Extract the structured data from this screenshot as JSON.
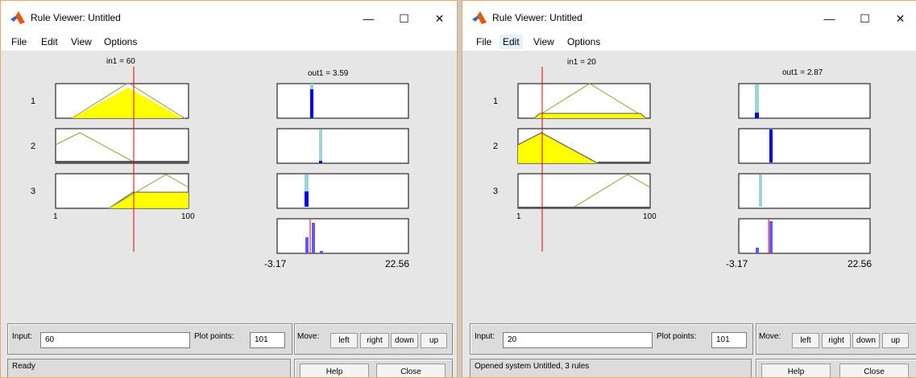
{
  "colors": {
    "membership_fill": "#ffff00",
    "membership_line": "#9a9a4a",
    "input_line": "#e00000",
    "output_bar": "#0000d8",
    "output_bar_light": "#a0d4d4",
    "aggregate_bar": "#5a5aff"
  },
  "windows": [
    {
      "title": "Rule Viewer: Untitled",
      "menu": [
        "File",
        "Edit",
        "View",
        "Options"
      ],
      "active_menu": -1,
      "caption_in": "in1 = 60",
      "caption_out": "out1 = 3.59",
      "rules": [
        "1",
        "2",
        "3"
      ],
      "input_axis": {
        "min": "1",
        "max": "100"
      },
      "output_range": {
        "min": "-3.17",
        "max": "22.56"
      },
      "input": {
        "label": "Input:",
        "value": "60"
      },
      "plot_points": {
        "label": "Plot points:",
        "value": "101"
      },
      "move": {
        "label": "Move:",
        "buttons": [
          "left",
          "right",
          "down",
          "up"
        ]
      },
      "status": "Ready",
      "buttons": {
        "help": "Help",
        "close": "Close"
      }
    },
    {
      "title": "Rule Viewer: Untitled",
      "menu": [
        "File",
        "Edit",
        "View",
        "Options"
      ],
      "active_menu": 1,
      "caption_in": "in1 = 20",
      "caption_out": "out1 = 2.87",
      "rules": [
        "1",
        "2",
        "3"
      ],
      "input_axis": {
        "min": "1",
        "max": "100"
      },
      "output_range": {
        "min": "-3.17",
        "max": "22.56"
      },
      "input": {
        "label": "Input:",
        "value": "20"
      },
      "plot_points": {
        "label": "Plot points:",
        "value": "101"
      },
      "move": {
        "label": "Move:",
        "buttons": [
          "left",
          "right",
          "down",
          "up"
        ]
      },
      "status": "Opened system Untitled, 3 rules",
      "buttons": {
        "help": "Help",
        "close": "Close"
      }
    }
  ]
}
